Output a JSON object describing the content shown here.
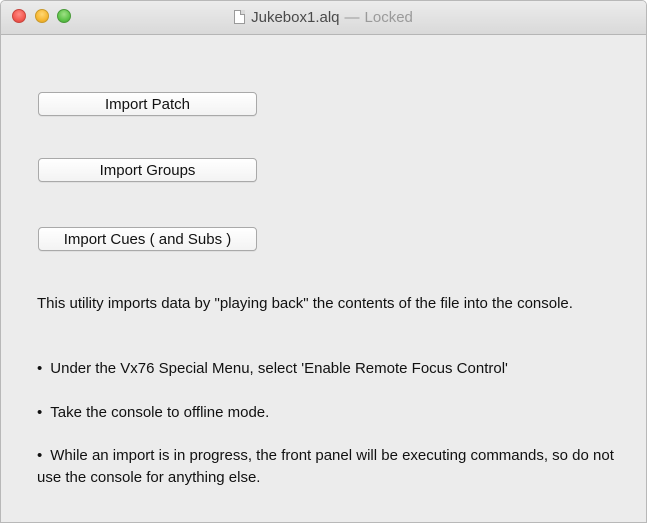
{
  "window": {
    "title": "Jukebox1.alq",
    "title_separator": "—",
    "title_status": "Locked"
  },
  "buttons": {
    "import_patch": "Import Patch",
    "import_groups": "Import Groups",
    "import_cues": "Import Cues ( and Subs )"
  },
  "instructions": {
    "intro": "This utility imports data by \"playing back\" the contents of the file into the console.",
    "bullet_symbol": "•",
    "bullets": [
      "Under the Vx76 Special Menu, select 'Enable Remote Focus Control'",
      "Take the console to offline mode.",
      "While an import is in progress, the front panel will be executing commands, so do not use the console for anything else."
    ]
  }
}
